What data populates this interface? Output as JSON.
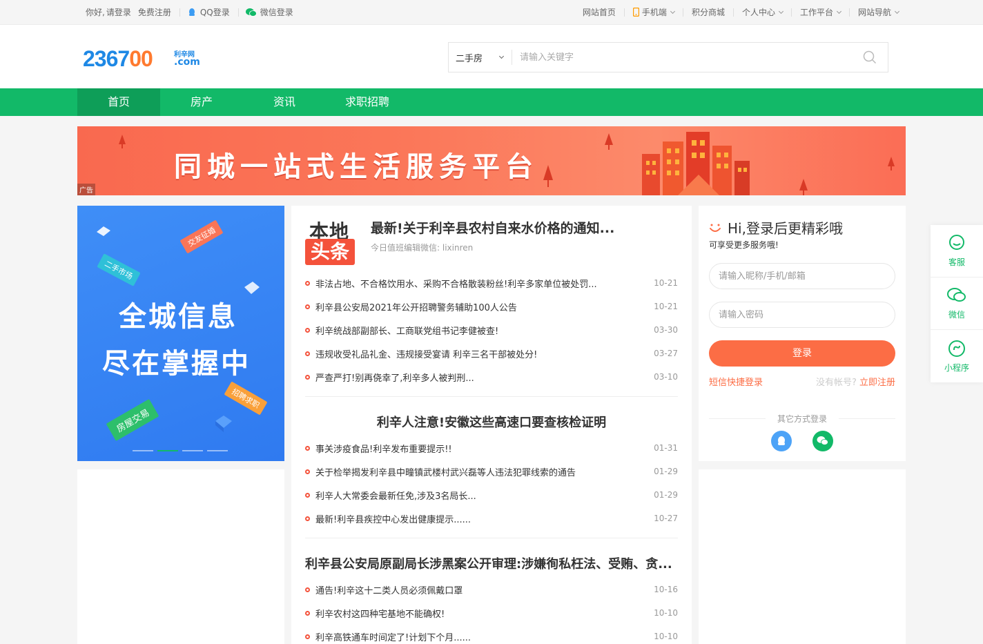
{
  "topbar": {
    "greeting": "你好,",
    "login": "请登录",
    "register": "免费注册",
    "qq_login": "QQ登录",
    "wechat_login": "微信登录",
    "links": [
      {
        "label": "网站首页"
      },
      {
        "label": "手机端"
      },
      {
        "label": "积分商城"
      },
      {
        "label": "个人中心"
      },
      {
        "label": "工作平台"
      },
      {
        "label": "网站导航"
      }
    ]
  },
  "logo": {
    "digits_a": "2367",
    "digits_b": "00",
    "site_name": "利辛网",
    "domain": ".com"
  },
  "search": {
    "category": "二手房",
    "placeholder": "请输入关键字"
  },
  "nav": {
    "tabs": [
      {
        "label": "首页"
      },
      {
        "label": "房产"
      },
      {
        "label": "资讯"
      },
      {
        "label": "求职招聘"
      }
    ]
  },
  "banner": {
    "slogan": "同城一站式生活服务平台",
    "ad_label": "广告"
  },
  "promo": {
    "line1": "全城信息",
    "line2": "尽在掌握中",
    "tags": [
      "二手市场",
      "交友征婚",
      "房屋交易",
      "招聘求职"
    ]
  },
  "news": {
    "badge_top": "本地",
    "badge_bottom": "头条",
    "headline": "最新!关于利辛县农村自来水价格的通知...",
    "editor": "今日值班编辑微信: lixinren",
    "group1": [
      {
        "title": "非法占地、不合格饮用水、采购不合格散装粉丝!利辛多家单位被处罚...",
        "date": "10-21"
      },
      {
        "title": "利辛县公安局2021年公开招聘警务辅助100人公告",
        "date": "10-21"
      },
      {
        "title": "利辛统战部副部长、工商联党组书记李健被查!",
        "date": "03-30"
      },
      {
        "title": "违规收受礼品礼金、违规接受宴请 利辛三名干部被处分!",
        "date": "03-27"
      },
      {
        "title": "严查严打!别再侥幸了,利辛多人被判刑...",
        "date": "03-10"
      }
    ],
    "subhead2": "利辛人注意!安徽这些高速口要查核检证明",
    "group2": [
      {
        "title": "事关涉疫食品!利辛发布重要提示!!",
        "date": "01-31"
      },
      {
        "title": "关于检举揭发利辛县中疃镇武楼村武兴磊等人违法犯罪线索的通告",
        "date": "01-29"
      },
      {
        "title": "利辛人大常委会最新任免,涉及3名局长...",
        "date": "01-29"
      },
      {
        "title": "最新!利辛县疾控中心发出健康提示......",
        "date": "10-27"
      }
    ],
    "subhead3": "利辛县公安局原副局长涉黑案公开审理:涉嫌徇私枉法、受贿、贪...",
    "group3": [
      {
        "title": "通告!利辛这十二类人员必须佩戴口罩",
        "date": "10-16"
      },
      {
        "title": "利辛农村这四种宅基地不能确权!",
        "date": "10-10"
      },
      {
        "title": "利辛高铁通车时间定了!计划下个月......",
        "date": "10-10"
      }
    ]
  },
  "login": {
    "hi": "Hi,登录后更精彩哦",
    "sub": "可享受更多服务哦!",
    "user_placeholder": "请输入昵称/手机/邮箱",
    "pass_placeholder": "请输入密码",
    "button": "登录",
    "sms": "短信快捷登录",
    "no_account": "没有帐号?",
    "register": "立即注册",
    "other": "其它方式登录"
  },
  "side": {
    "items": [
      {
        "label": "客服"
      },
      {
        "label": "微信"
      },
      {
        "label": "小程序"
      }
    ]
  },
  "colors": {
    "brand_green": "#12b968",
    "accent_orange": "#fc6d45",
    "news_red": "#f4523b"
  }
}
